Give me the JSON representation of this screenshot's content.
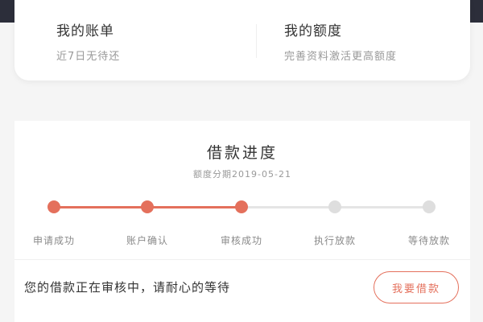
{
  "summary": {
    "items": [
      {
        "title": "我的账单",
        "subtitle": "近7日无待还"
      },
      {
        "title": "我的额度",
        "subtitle": "完善资料激活更高额度"
      }
    ]
  },
  "progress": {
    "title": "借款进度",
    "date": "额度分期2019-05-21",
    "current_step": 3,
    "steps": [
      {
        "label": "申请成功",
        "done": true
      },
      {
        "label": "账户确认",
        "done": true
      },
      {
        "label": "审核成功",
        "done": true
      },
      {
        "label": "执行放款",
        "done": false
      },
      {
        "label": "等待放款",
        "done": false
      }
    ],
    "status_message": "您的借款正在审核中，请耐心的等待",
    "bill_button_label": "我要借款"
  },
  "colors": {
    "accent": "#e4705c",
    "inactive": "#dedede",
    "header_dark": "#2c2e3a"
  }
}
